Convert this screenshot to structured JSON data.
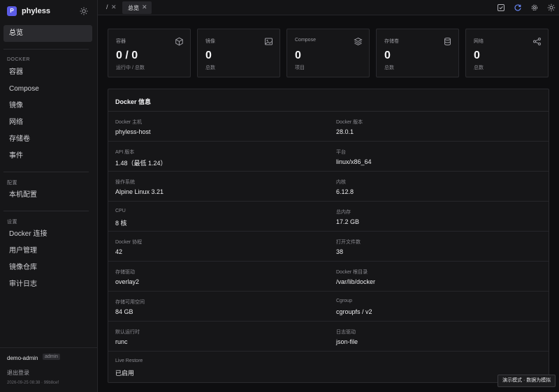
{
  "brand": {
    "logo_letter": "P",
    "name": "phyless"
  },
  "sidebar": {
    "top_item": "总览",
    "docker_section": "DOCKER",
    "docker_items": [
      "容器",
      "Compose",
      "镜像",
      "网络",
      "存储卷",
      "事件"
    ],
    "config_section": "配置",
    "config_items": [
      "本机配置"
    ],
    "settings_section": "设置",
    "settings_items": [
      "Docker 连接",
      "用户管理",
      "镜像仓库",
      "审计日志"
    ]
  },
  "user": {
    "name": "demo-admin",
    "role": "admin",
    "logout": "退出登录",
    "build": "2026-09-25 08:38 · 99b8cef"
  },
  "tabs": {
    "root": "/",
    "close": "✕",
    "active": "总览"
  },
  "cards": [
    {
      "label": "容器",
      "value": "0 / 0",
      "sub": "运行中 / 总数",
      "icon": "cube-icon"
    },
    {
      "label": "镜像",
      "value": "0",
      "sub": "总数",
      "icon": "image-icon"
    },
    {
      "label": "Compose",
      "value": "0",
      "sub": "项目",
      "icon": "layers-icon"
    },
    {
      "label": "存储卷",
      "value": "0",
      "sub": "总数",
      "icon": "database-icon"
    },
    {
      "label": "网络",
      "value": "0",
      "sub": "总数",
      "icon": "share-icon"
    }
  ],
  "info": {
    "title": "Docker 信息",
    "rows": [
      [
        {
          "k": "Docker 主机",
          "v": "phyless-host"
        },
        {
          "k": "Docker 版本",
          "v": "28.0.1"
        }
      ],
      [
        {
          "k": "API 版本",
          "v": "1.48（最低 1.24）"
        },
        {
          "k": "平台",
          "v": "linux/x86_64"
        }
      ],
      [
        {
          "k": "操作系统",
          "v": "Alpine Linux 3.21"
        },
        {
          "k": "内核",
          "v": "6.12.8"
        }
      ],
      [
        {
          "k": "CPU",
          "v": "8 核"
        },
        {
          "k": "总内存",
          "v": "17.2 GB"
        }
      ],
      [
        {
          "k": "Docker 协程",
          "v": "42"
        },
        {
          "k": "打开文件数",
          "v": "38"
        }
      ],
      [
        {
          "k": "存储驱动",
          "v": "overlay2"
        },
        {
          "k": "Docker 根目录",
          "v": "/var/lib/docker"
        }
      ],
      [
        {
          "k": "存储可用空间",
          "v": "84 GB"
        },
        {
          "k": "Cgroup",
          "v": "cgroupfs / v2"
        }
      ],
      [
        {
          "k": "默认运行时",
          "v": "runc"
        },
        {
          "k": "日志驱动",
          "v": "json-file"
        }
      ],
      [
        {
          "k": "Live Restore",
          "v": "已启用"
        }
      ]
    ]
  },
  "toast": "演示模式 · 数据为模拟",
  "colors": {
    "accent": "#5b5ce6",
    "background": "#0e0e10",
    "surface": "#161618",
    "border": "#2a2a2e"
  }
}
